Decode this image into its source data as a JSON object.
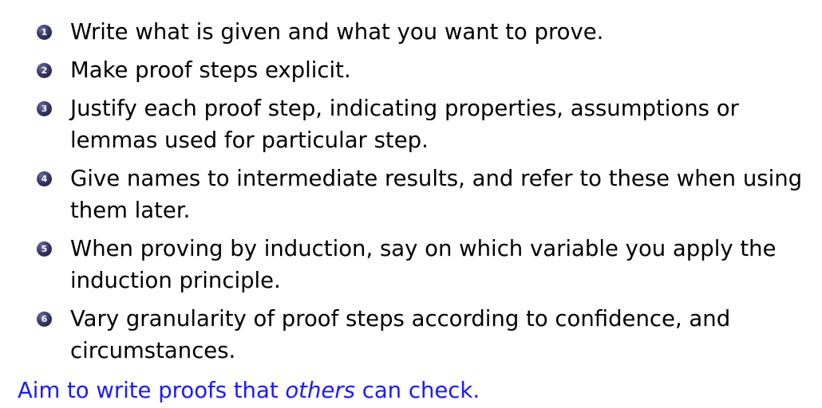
{
  "colors": {
    "text": "#000000",
    "accent_blue": "#1a1aff",
    "badge": "#32325e"
  },
  "steps": [
    {
      "number": "1",
      "text": "Write what is given and what you want to prove."
    },
    {
      "number": "2",
      "text": "Make proof steps explicit."
    },
    {
      "number": "3",
      "text": "Justify each proof step, indicating properties, assumptions or lemmas used for particular step."
    },
    {
      "number": "4",
      "text": "Give names to intermediate results, and refer to these when using them later."
    },
    {
      "number": "5",
      "text": "When proving by induction, say on which variable you apply the induction principle."
    },
    {
      "number": "6",
      "text": "Vary granularity of proof steps according to confidence, and circumstances."
    }
  ],
  "conclusion": {
    "before": "Aim to write proofs that ",
    "emphasis": "others",
    "after": " can check."
  }
}
